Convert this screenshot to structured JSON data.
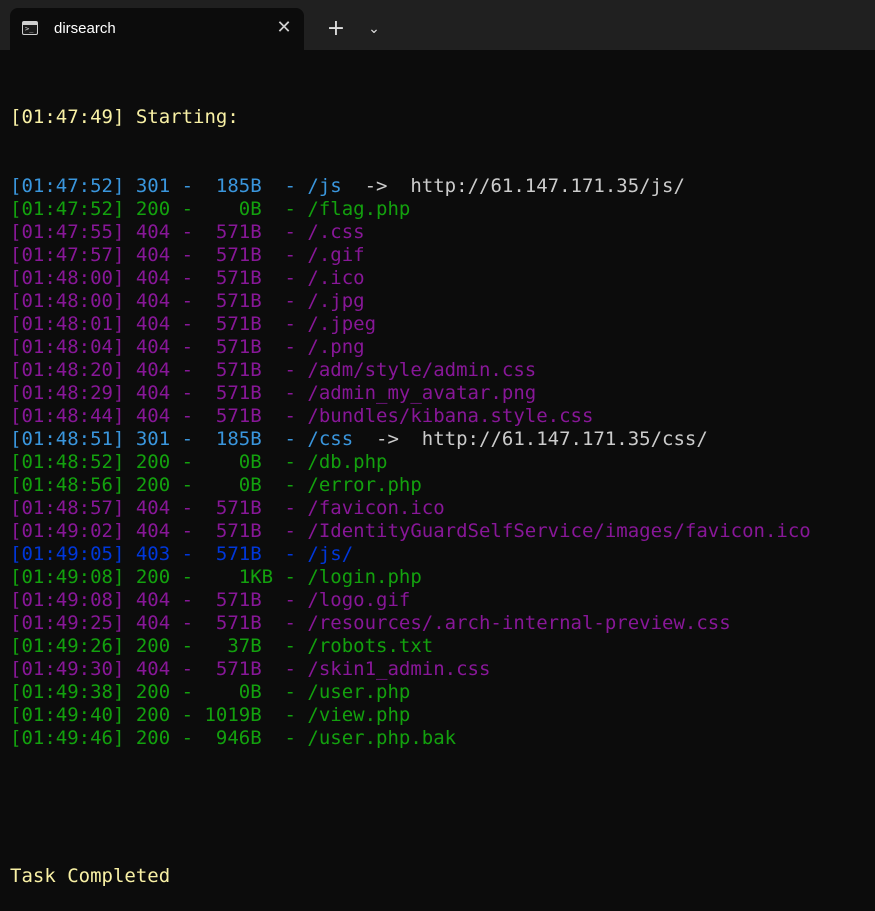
{
  "window": {
    "tab_title": "dirsearch",
    "tab_icon_glyph": ">_",
    "close_glyph": "✕",
    "new_tab_glyph": "+",
    "dropdown_glyph": "⌄"
  },
  "colors": {
    "yellow": "#f9f1a5",
    "light_blue": "#3a96dd",
    "green": "#13a10e",
    "magenta": "#881798",
    "blue": "#0037da",
    "white": "#cccccc"
  },
  "terminal": {
    "start_line": "[01:47:49] Starting:",
    "lines": [
      {
        "text": "[01:47:52] 301 -  185B  - /js",
        "redirect": "  ->  http://61.147.171.35/js/",
        "color": "lblue"
      },
      {
        "text": "[01:47:52] 200 -    0B  - /flag.php",
        "redirect": "",
        "color": "green"
      },
      {
        "text": "[01:47:55] 404 -  571B  - /.css",
        "redirect": "",
        "color": "magenta"
      },
      {
        "text": "[01:47:57] 404 -  571B  - /.gif",
        "redirect": "",
        "color": "magenta"
      },
      {
        "text": "[01:48:00] 404 -  571B  - /.ico",
        "redirect": "",
        "color": "magenta"
      },
      {
        "text": "[01:48:00] 404 -  571B  - /.jpg",
        "redirect": "",
        "color": "magenta"
      },
      {
        "text": "[01:48:01] 404 -  571B  - /.jpeg",
        "redirect": "",
        "color": "magenta"
      },
      {
        "text": "[01:48:04] 404 -  571B  - /.png",
        "redirect": "",
        "color": "magenta"
      },
      {
        "text": "[01:48:20] 404 -  571B  - /adm/style/admin.css",
        "redirect": "",
        "color": "magenta"
      },
      {
        "text": "[01:48:29] 404 -  571B  - /admin_my_avatar.png",
        "redirect": "",
        "color": "magenta"
      },
      {
        "text": "[01:48:44] 404 -  571B  - /bundles/kibana.style.css",
        "redirect": "",
        "color": "magenta"
      },
      {
        "text": "[01:48:51] 301 -  185B  - /css",
        "redirect": "  ->  http://61.147.171.35/css/",
        "color": "lblue"
      },
      {
        "text": "[01:48:52] 200 -    0B  - /db.php",
        "redirect": "",
        "color": "green"
      },
      {
        "text": "[01:48:56] 200 -    0B  - /error.php",
        "redirect": "",
        "color": "green"
      },
      {
        "text": "[01:48:57] 404 -  571B  - /favicon.ico",
        "redirect": "",
        "color": "magenta"
      },
      {
        "text": "[01:49:02] 404 -  571B  - /IdentityGuardSelfService/images/favicon.ico",
        "redirect": "",
        "color": "magenta"
      },
      {
        "text": "[01:49:05] 403 -  571B  - /js/",
        "redirect": "",
        "color": "blue"
      },
      {
        "text": "[01:49:08] 200 -    1KB - /login.php",
        "redirect": "",
        "color": "green"
      },
      {
        "text": "[01:49:08] 404 -  571B  - /logo.gif",
        "redirect": "",
        "color": "magenta"
      },
      {
        "text": "[01:49:25] 404 -  571B  - /resources/.arch-internal-preview.css",
        "redirect": "",
        "color": "magenta"
      },
      {
        "text": "[01:49:26] 200 -   37B  - /robots.txt",
        "redirect": "",
        "color": "green"
      },
      {
        "text": "[01:49:30] 404 -  571B  - /skin1_admin.css",
        "redirect": "",
        "color": "magenta"
      },
      {
        "text": "[01:49:38] 200 -    0B  - /user.php",
        "redirect": "",
        "color": "green"
      },
      {
        "text": "[01:49:40] 200 - 1019B  - /view.php",
        "redirect": "",
        "color": "green"
      },
      {
        "text": "[01:49:46] 200 -  946B  - /user.php.bak",
        "redirect": "",
        "color": "green"
      }
    ],
    "end_line": "Task Completed"
  }
}
